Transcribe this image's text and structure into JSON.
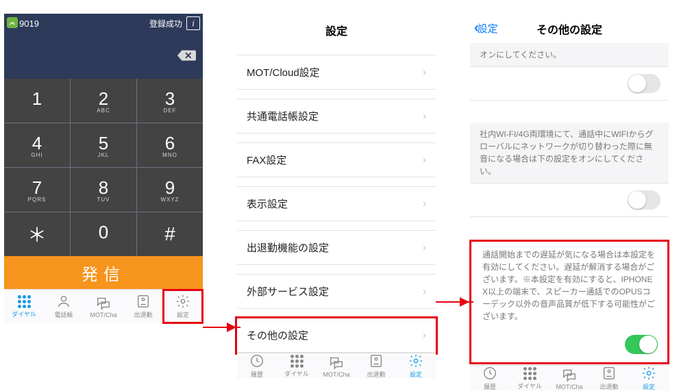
{
  "screen1": {
    "extension": "9019",
    "status": "登録成功",
    "keys": {
      "k1": "1",
      "k2": "2",
      "k2s": "ABC",
      "k3": "3",
      "k3s": "DEF",
      "k4": "4",
      "k4s": "GHI",
      "k5": "5",
      "k5s": "JKL",
      "k6": "6",
      "k6s": "MNO",
      "k7": "7",
      "k7s": "PQRS",
      "k8": "8",
      "k8s": "TUV",
      "k9": "9",
      "k9s": "WXYZ",
      "kstar": "＊",
      "k0": "0",
      "khash": "#"
    },
    "call": "発信",
    "tabs": {
      "t1": "ダイヤル",
      "t2": "電話帳",
      "t3": "MOT/Cha",
      "t4": "出退勤",
      "t5": "設定"
    }
  },
  "screen2": {
    "title": "設定",
    "items": {
      "i0": "MOT/Cloud設定",
      "i1": "共通電話帳設定",
      "i2": "FAX設定",
      "i3": "表示設定",
      "i4": "出退勤機能の設定",
      "i5": "外部サービス設定",
      "i6": "その他の設定"
    },
    "tabs": {
      "t1": "履歴",
      "t2": "ダイヤル",
      "t3": "MOT/Cha",
      "t4": "出退勤",
      "t5": "設定"
    }
  },
  "screen3": {
    "back": "設定",
    "title": "その他の設定",
    "sec1": "オンにしてください。",
    "sec2": "社内WI-FI/4G両環境にて、通話中にWIFIからグローバルにネットワークが切り替わった際に無音になる場合は下の設定をオンにしてください。",
    "sec3": "通話開始までの遅延が気になる場合は本設定を有効にしてください。遅延が解消する場合がございます。※本設定を有効にすると、IPHONE X以上の端末で、スピーカー通話でのOPUSコーデック以外の音声品質が低下する可能性がございます。",
    "tabs": {
      "t1": "履歴",
      "t2": "ダイヤル",
      "t3": "MOT/Cha",
      "t4": "出退勤",
      "t5": "設定"
    }
  }
}
